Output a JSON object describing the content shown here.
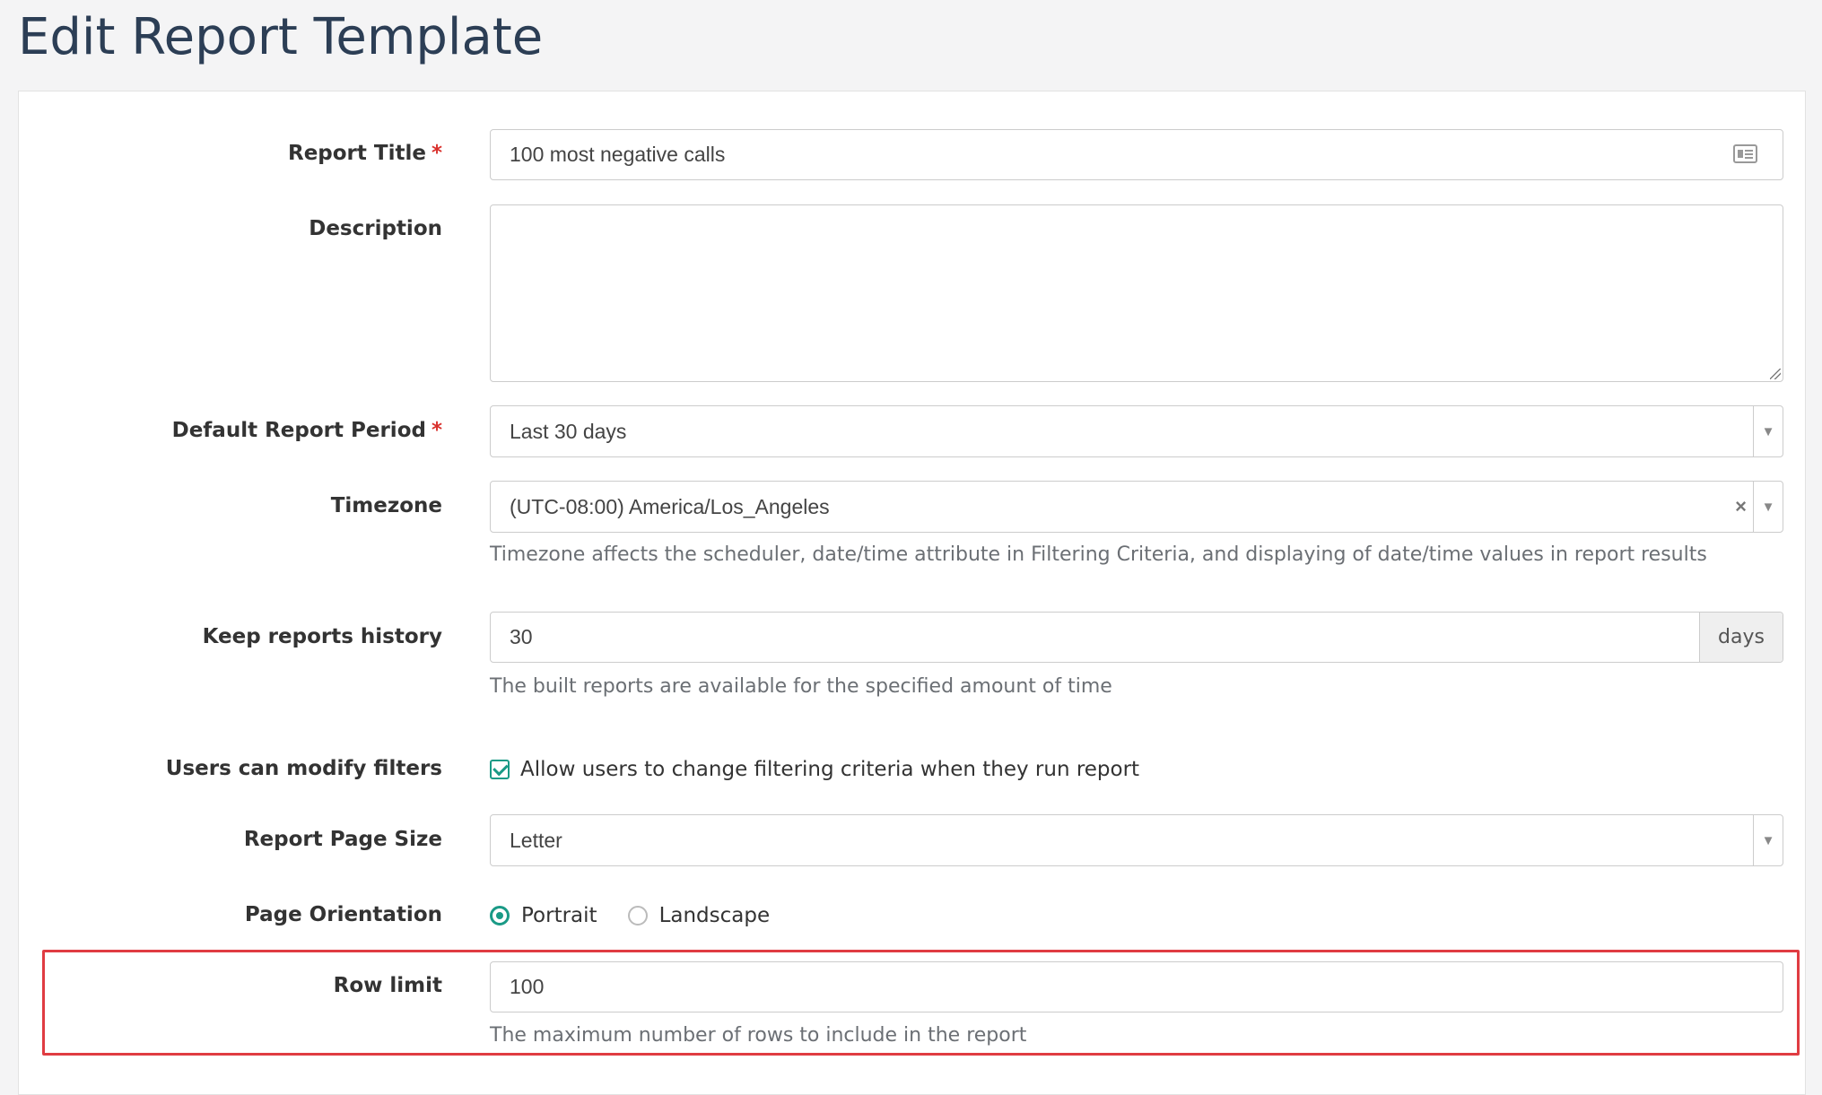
{
  "page": {
    "title": "Edit Report Template"
  },
  "form": {
    "report_title": {
      "label": "Report Title",
      "required_mark": "*",
      "value": "100 most negative calls",
      "icon": "contact-card-icon"
    },
    "description": {
      "label": "Description",
      "value": ""
    },
    "default_report_period": {
      "label": "Default Report Period",
      "required_mark": "*",
      "value": "Last 30 days"
    },
    "timezone": {
      "label": "Timezone",
      "value": "(UTC-08:00) America/Los_Angeles",
      "clear": "×",
      "help": "Timezone affects the scheduler, date/time attribute in Filtering Criteria, and displaying of date/time values in report results"
    },
    "keep_history": {
      "label": "Keep reports history",
      "value": "30",
      "addon": "days",
      "help": "The built reports are available for the specified amount of time"
    },
    "users_modify": {
      "label": "Users can modify filters",
      "checkbox_label": "Allow users to change filtering criteria when they run report",
      "checked": true
    },
    "page_size": {
      "label": "Report Page Size",
      "value": "Letter"
    },
    "orientation": {
      "label": "Page Orientation",
      "options": [
        "Portrait",
        "Landscape"
      ],
      "selected": "Portrait"
    },
    "row_limit": {
      "label": "Row limit",
      "value": "100",
      "help": "The maximum number of rows to include in the report"
    }
  },
  "colors": {
    "accent": "#1a9a86",
    "required": "#d9302c",
    "highlight": "#e03c42",
    "title": "#2c3e55"
  }
}
